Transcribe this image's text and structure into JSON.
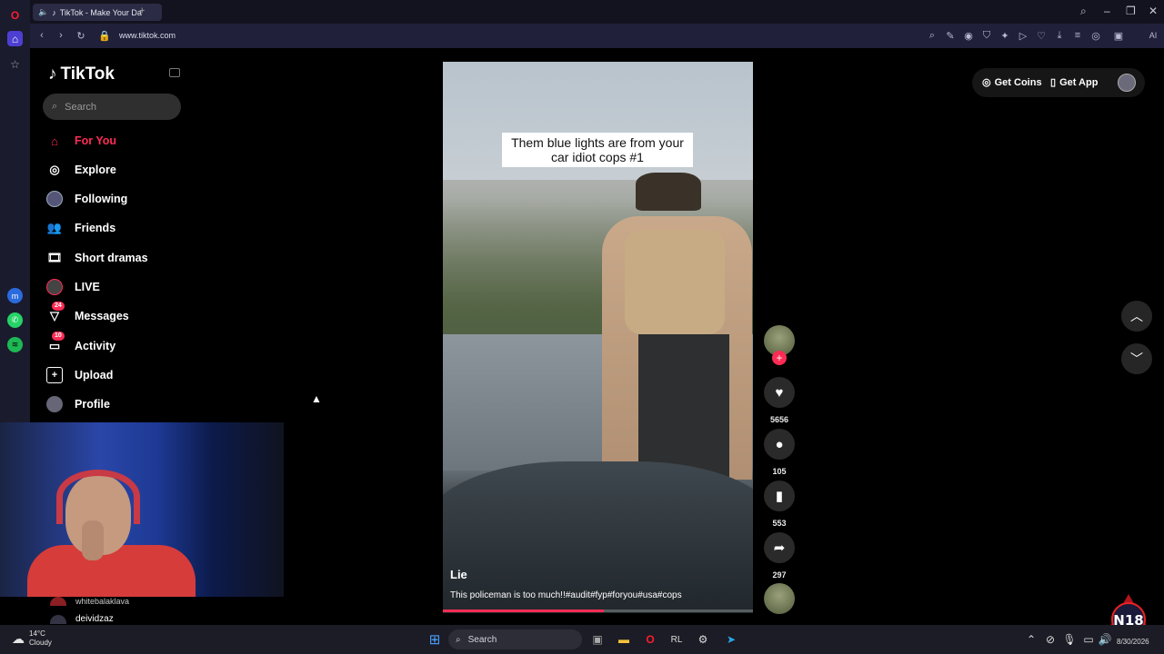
{
  "browser": {
    "tab_title": "TikTok - Make Your Da",
    "url": "www.tiktok.com"
  },
  "sidebar": {
    "logo": "TikTok",
    "search_placeholder": "Search",
    "items": [
      {
        "label": "For You",
        "icon": "home-icon",
        "active": true
      },
      {
        "label": "Explore",
        "icon": "compass-icon"
      },
      {
        "label": "Following",
        "icon": "following-avatar-icon"
      },
      {
        "label": "Friends",
        "icon": "friends-icon"
      },
      {
        "label": "Short dramas",
        "icon": "film-icon"
      },
      {
        "label": "LIVE",
        "icon": "live-avatar-icon"
      },
      {
        "label": "Messages",
        "icon": "messages-icon",
        "badge": "24"
      },
      {
        "label": "Activity",
        "icon": "activity-icon",
        "badge": "10"
      },
      {
        "label": "Upload",
        "icon": "upload-icon"
      },
      {
        "label": "Profile",
        "icon": "profile-avatar-icon"
      }
    ]
  },
  "video": {
    "overlay_caption": "Them blue lights are from your car idiot cops #1",
    "title": "Lie",
    "description": "This policeman is too much!!#audit#fyp#foryou#usa#cops",
    "progress": 0.52
  },
  "actions": {
    "likes": "5656",
    "comments": "105",
    "saves": "553",
    "shares": "297"
  },
  "topright": {
    "get_coins": "Get Coins",
    "get_app": "Get App"
  },
  "chat": {
    "user1": "whitebalaklava",
    "user2": "deividzaz"
  },
  "taskbar": {
    "temp": "14°C",
    "weather": "Cloudy",
    "search": "Search",
    "date": "8/30/2026"
  },
  "overlay_logo": "N18",
  "colors": {
    "accent": "#fe2c55",
    "browser_bg": "#20203a"
  }
}
